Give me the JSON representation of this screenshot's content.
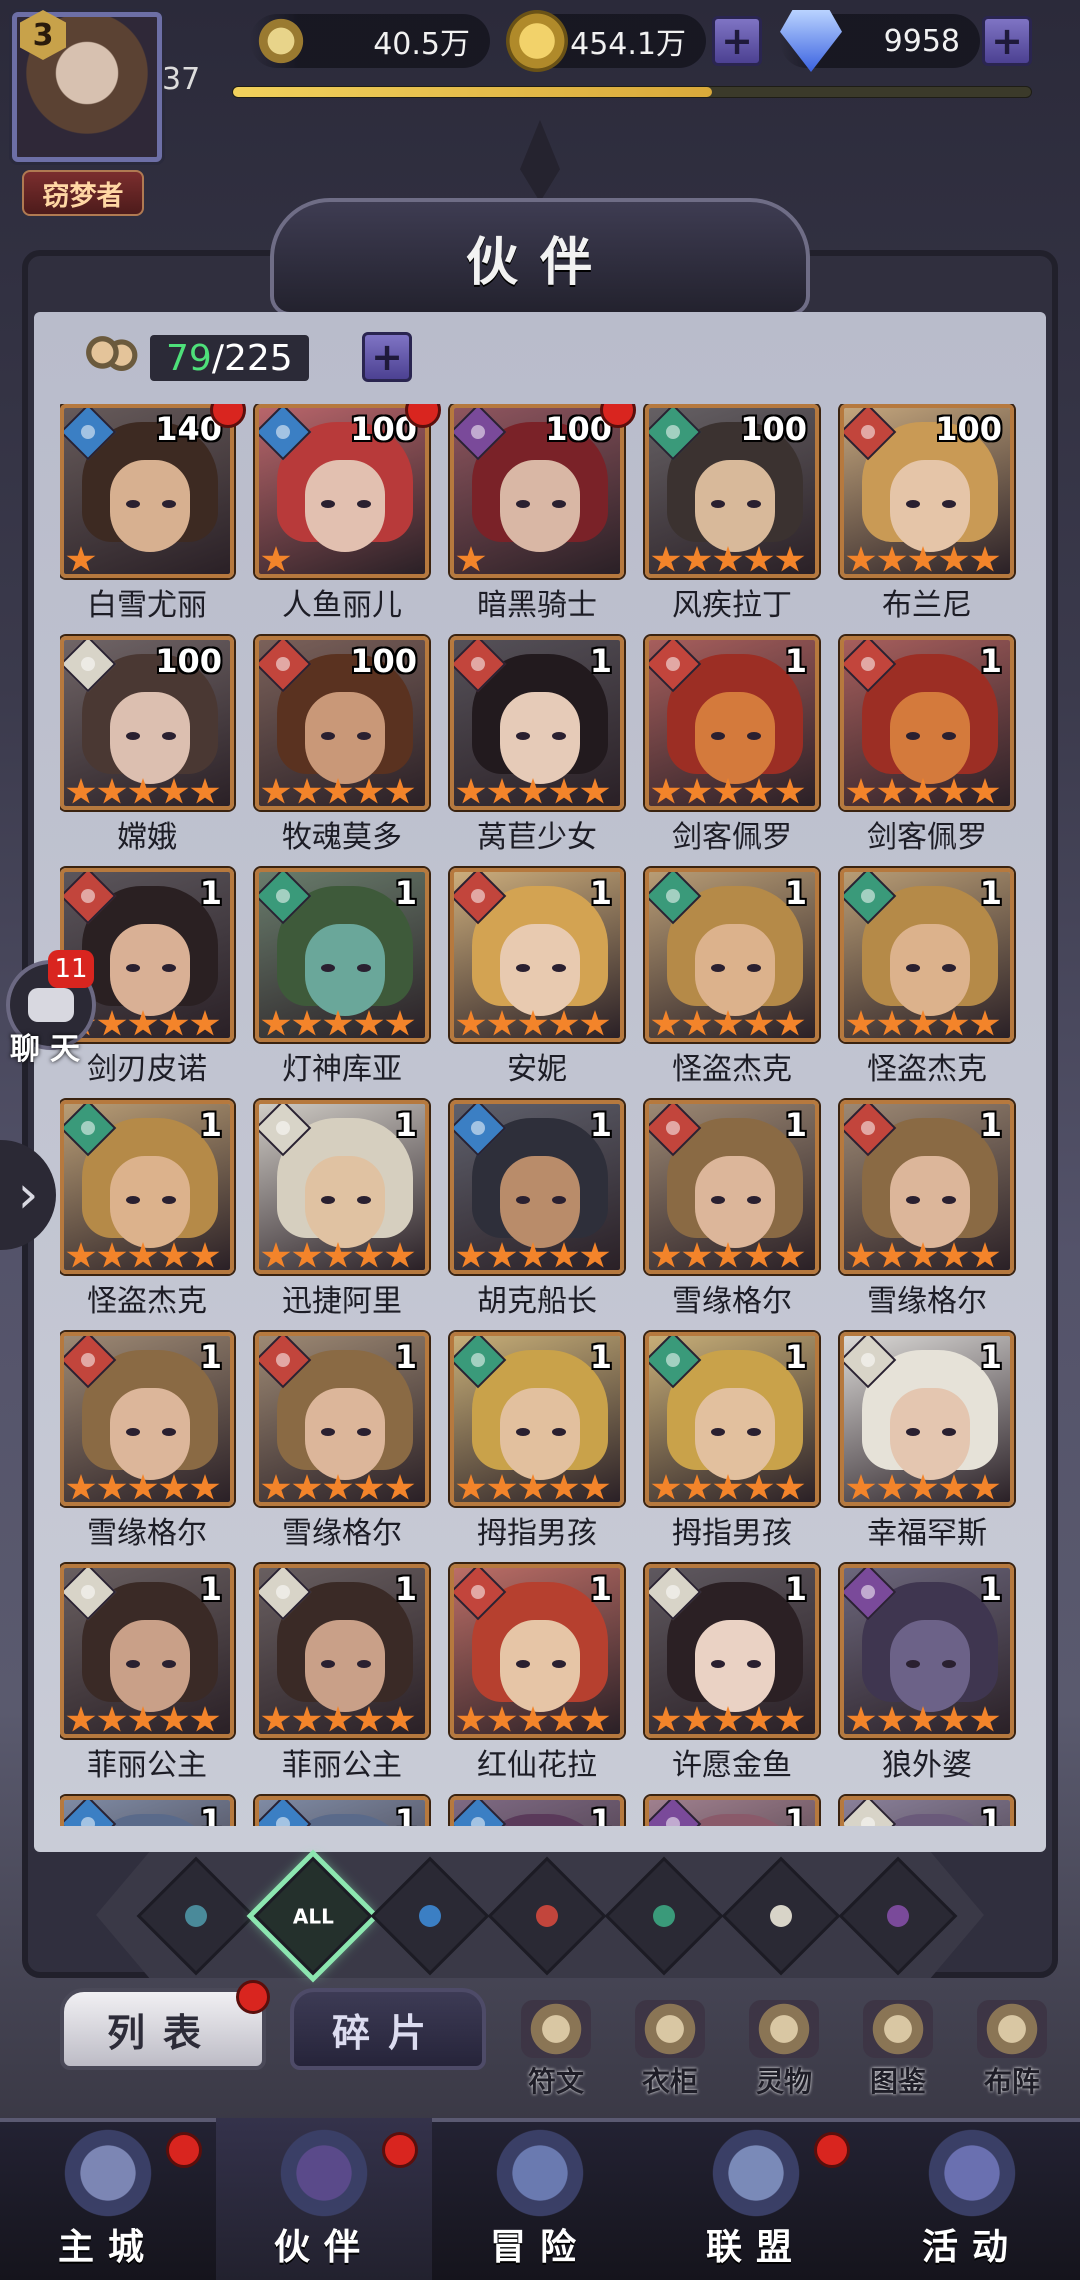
{
  "player": {
    "level_badge": "3",
    "level": "37",
    "title": "窃梦者",
    "xp_progress": 0.6
  },
  "resources": [
    {
      "name": "power",
      "icon": "sword-icon",
      "value": "40.5万",
      "plus": false
    },
    {
      "name": "gold",
      "icon": "gold-coin-icon",
      "value": "454.1万",
      "plus": true
    },
    {
      "name": "diamond",
      "icon": "diamond-icon",
      "value": "9958",
      "plus": true
    }
  ],
  "header": {
    "title": "伙伴"
  },
  "companion_count": {
    "current": "79",
    "max": "/225"
  },
  "colors": {
    "water": "#3b7fc4",
    "fire": "#c2453c",
    "wind": "#3a9a7a",
    "light": "#d8d4c8",
    "dark": "#7a4a9a",
    "star": "#f3842a",
    "frame": "#b6793e"
  },
  "heroes": [
    {
      "name": "白雪尤丽",
      "level": "140",
      "stars": 1,
      "element": "water",
      "dot": true,
      "hair": "#3d2a22",
      "skin": "#d7b090"
    },
    {
      "name": "人鱼丽儿",
      "level": "100",
      "stars": 1,
      "element": "water",
      "dot": true,
      "hair": "#b83a3a",
      "skin": "#e2c0b0"
    },
    {
      "name": "暗黑骑士",
      "level": "100",
      "stars": 1,
      "element": "dark",
      "dot": true,
      "hair": "#7a2228",
      "skin": "#d9b7a5"
    },
    {
      "name": "风疾拉丁",
      "level": "100",
      "stars": 5,
      "element": "wind",
      "dot": false,
      "hair": "#3b3230",
      "skin": "#d8b99a"
    },
    {
      "name": "布兰尼",
      "level": "100",
      "stars": 5,
      "element": "fire",
      "dot": false,
      "hair": "#c99a55",
      "skin": "#e5c5a8"
    },
    {
      "name": "嫦娥",
      "level": "100",
      "stars": 5,
      "element": "light",
      "dot": false,
      "hair": "#4a3833",
      "skin": "#dcbfb0"
    },
    {
      "name": "牧魂莫多",
      "level": "100",
      "stars": 5,
      "element": "fire",
      "dot": false,
      "hair": "#5a3220",
      "skin": "#c99878"
    },
    {
      "name": "莴苣少女",
      "level": "1",
      "stars": 5,
      "element": "fire",
      "dot": false,
      "hair": "#221a1e",
      "skin": "#e6cbb8"
    },
    {
      "name": "剑客佩罗",
      "level": "1",
      "stars": 5,
      "element": "fire",
      "dot": false,
      "hair": "#9c2e24",
      "skin": "#d47a3c"
    },
    {
      "name": "剑客佩罗",
      "level": "1",
      "stars": 5,
      "element": "fire",
      "dot": false,
      "hair": "#9c2e24",
      "skin": "#d47a3c"
    },
    {
      "name": "剑刃皮诺",
      "level": "1",
      "stars": 5,
      "element": "fire",
      "dot": false,
      "hair": "#2a2022",
      "skin": "#d9b095"
    },
    {
      "name": "灯神库亚",
      "level": "1",
      "stars": 5,
      "element": "wind",
      "dot": false,
      "hair": "#3e5a3a",
      "skin": "#6aa79a"
    },
    {
      "name": "安妮",
      "level": "1",
      "stars": 5,
      "element": "fire",
      "dot": false,
      "hair": "#d3a352",
      "skin": "#e8cab0"
    },
    {
      "name": "怪盗杰克",
      "level": "1",
      "stars": 5,
      "element": "wind",
      "dot": false,
      "hair": "#b58a48",
      "skin": "#dcb28c"
    },
    {
      "name": "怪盗杰克",
      "level": "1",
      "stars": 5,
      "element": "wind",
      "dot": false,
      "hair": "#b58a48",
      "skin": "#dcb28c"
    },
    {
      "name": "怪盗杰克",
      "level": "1",
      "stars": 5,
      "element": "wind",
      "dot": false,
      "hair": "#b58a48",
      "skin": "#dcb28c"
    },
    {
      "name": "迅捷阿里",
      "level": "1",
      "stars": 5,
      "element": "light",
      "dot": false,
      "hair": "#d6cfbf",
      "skin": "#e0c2a2"
    },
    {
      "name": "胡克船长",
      "level": "1",
      "stars": 5,
      "element": "water",
      "dot": false,
      "hair": "#2e2f3a",
      "skin": "#b98c6a"
    },
    {
      "name": "雪缘格尔",
      "level": "1",
      "stars": 5,
      "element": "fire",
      "dot": false,
      "hair": "#8a6a44",
      "skin": "#dcb69a"
    },
    {
      "name": "雪缘格尔",
      "level": "1",
      "stars": 5,
      "element": "fire",
      "dot": false,
      "hair": "#8a6a44",
      "skin": "#dcb69a"
    },
    {
      "name": "雪缘格尔",
      "level": "1",
      "stars": 5,
      "element": "fire",
      "dot": false,
      "hair": "#8a6a44",
      "skin": "#dcb69a"
    },
    {
      "name": "雪缘格尔",
      "level": "1",
      "stars": 5,
      "element": "fire",
      "dot": false,
      "hair": "#8a6a44",
      "skin": "#dcb69a"
    },
    {
      "name": "拇指男孩",
      "level": "1",
      "stars": 5,
      "element": "wind",
      "dot": false,
      "hair": "#c9a24a",
      "skin": "#e2c09e"
    },
    {
      "name": "拇指男孩",
      "level": "1",
      "stars": 5,
      "element": "wind",
      "dot": false,
      "hair": "#c9a24a",
      "skin": "#e2c09e"
    },
    {
      "name": "幸福罕斯",
      "level": "1",
      "stars": 5,
      "element": "light",
      "dot": false,
      "hair": "#e6e2d8",
      "skin": "#e4c6b0"
    },
    {
      "name": "菲丽公主",
      "level": "1",
      "stars": 5,
      "element": "light",
      "dot": false,
      "hair": "#3a2a26",
      "skin": "#c9a088"
    },
    {
      "name": "菲丽公主",
      "level": "1",
      "stars": 5,
      "element": "light",
      "dot": false,
      "hair": "#3a2a26",
      "skin": "#c9a088"
    },
    {
      "name": "红仙花拉",
      "level": "1",
      "stars": 5,
      "element": "fire",
      "dot": false,
      "hair": "#b6402f",
      "skin": "#e6c5a6"
    },
    {
      "name": "许愿金鱼",
      "level": "1",
      "stars": 5,
      "element": "light",
      "dot": false,
      "hair": "#2b2024",
      "skin": "#ead2c4"
    },
    {
      "name": "狼外婆",
      "level": "1",
      "stars": 5,
      "element": "dark",
      "dot": false,
      "hair": "#3f3650",
      "skin": "#6c6288"
    },
    {
      "name": "",
      "level": "1",
      "stars": 0,
      "element": "water",
      "dot": false,
      "hair": "#5a6a8a",
      "skin": "#c4b0b8"
    },
    {
      "name": "",
      "level": "1",
      "stars": 0,
      "element": "water",
      "dot": false,
      "hair": "#5a6a8a",
      "skin": "#c4b0b8"
    },
    {
      "name": "",
      "level": "1",
      "stars": 0,
      "element": "water",
      "dot": false,
      "hair": "#5a3a5a",
      "skin": "#c4b0b8"
    },
    {
      "name": "",
      "level": "1",
      "stars": 0,
      "element": "dark",
      "dot": false,
      "hair": "#8a5a6a",
      "skin": "#c4b0b8"
    },
    {
      "name": "",
      "level": "1",
      "stars": 0,
      "element": "light",
      "dot": false,
      "hair": "#6a5a7a",
      "skin": "#c4b0b8"
    }
  ],
  "chat": {
    "label": "聊天",
    "badge": "11"
  },
  "filters": [
    {
      "id": "all-elements",
      "label": "",
      "color": "#4a8a9a"
    },
    {
      "id": "all",
      "label": "ALL",
      "color": "#2c4a40",
      "active": true
    },
    {
      "id": "water",
      "label": "",
      "color": "#3b7fc4"
    },
    {
      "id": "fire",
      "label": "",
      "color": "#c2453c"
    },
    {
      "id": "wind",
      "label": "",
      "color": "#3a9a7a"
    },
    {
      "id": "light",
      "label": "",
      "color": "#d8d4c8"
    },
    {
      "id": "dark",
      "label": "",
      "color": "#7a4a9a"
    }
  ],
  "tabs": {
    "list": "列表",
    "fragments": "碎片"
  },
  "tools": [
    "符文",
    "衣柜",
    "灵物",
    "图鉴",
    "布阵"
  ],
  "nav": [
    {
      "label": "主城",
      "dot": true
    },
    {
      "label": "伙伴",
      "dot": true,
      "active": true
    },
    {
      "label": "冒险",
      "dot": false
    },
    {
      "label": "联盟",
      "dot": true
    },
    {
      "label": "活动",
      "dot": false
    }
  ]
}
